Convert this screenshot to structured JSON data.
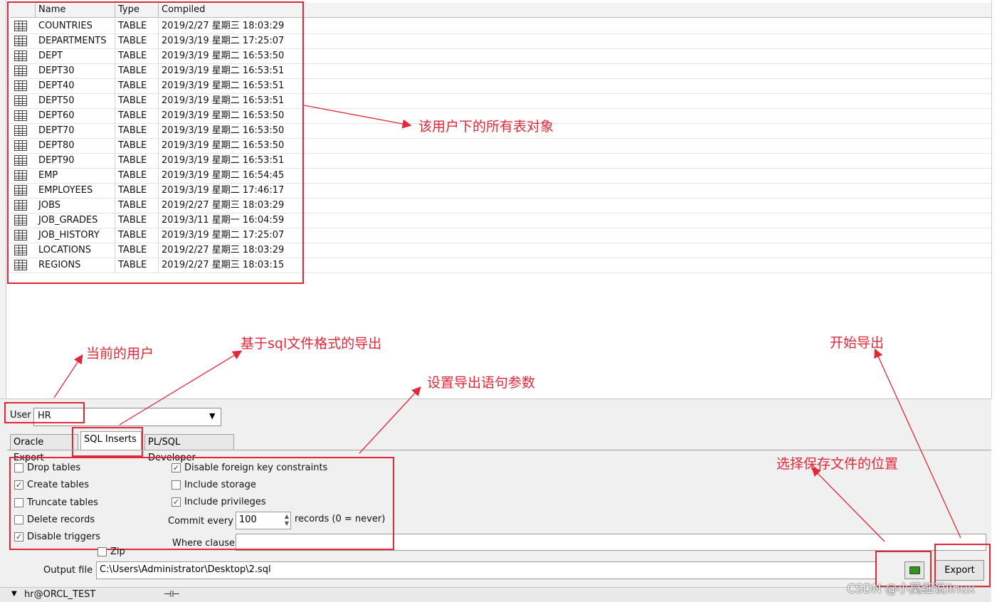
{
  "columns": [
    "Name",
    "Type",
    "Compiled"
  ],
  "tables": [
    {
      "name": "COUNTRIES",
      "type": "TABLE",
      "compiled": "2019/2/27 星期三 18:03:29"
    },
    {
      "name": "DEPARTMENTS",
      "type": "TABLE",
      "compiled": "2019/3/19 星期二 17:25:07"
    },
    {
      "name": "DEPT",
      "type": "TABLE",
      "compiled": "2019/3/19 星期二 16:53:50"
    },
    {
      "name": "DEPT30",
      "type": "TABLE",
      "compiled": "2019/3/19 星期二 16:53:51"
    },
    {
      "name": "DEPT40",
      "type": "TABLE",
      "compiled": "2019/3/19 星期二 16:53:51"
    },
    {
      "name": "DEPT50",
      "type": "TABLE",
      "compiled": "2019/3/19 星期二 16:53:51"
    },
    {
      "name": "DEPT60",
      "type": "TABLE",
      "compiled": "2019/3/19 星期二 16:53:50"
    },
    {
      "name": "DEPT70",
      "type": "TABLE",
      "compiled": "2019/3/19 星期二 16:53:50"
    },
    {
      "name": "DEPT80",
      "type": "TABLE",
      "compiled": "2019/3/19 星期二 16:53:50"
    },
    {
      "name": "DEPT90",
      "type": "TABLE",
      "compiled": "2019/3/19 星期二 16:53:51"
    },
    {
      "name": "EMP",
      "type": "TABLE",
      "compiled": "2019/3/19 星期二 16:54:45"
    },
    {
      "name": "EMPLOYEES",
      "type": "TABLE",
      "compiled": "2019/3/19 星期二 17:46:17"
    },
    {
      "name": "JOBS",
      "type": "TABLE",
      "compiled": "2019/2/27 星期三 18:03:29"
    },
    {
      "name": "JOB_GRADES",
      "type": "TABLE",
      "compiled": "2019/3/11 星期一 16:04:59"
    },
    {
      "name": "JOB_HISTORY",
      "type": "TABLE",
      "compiled": "2019/3/19 星期二 17:25:07"
    },
    {
      "name": "LOCATIONS",
      "type": "TABLE",
      "compiled": "2019/2/27 星期三 18:03:29"
    },
    {
      "name": "REGIONS",
      "type": "TABLE",
      "compiled": "2019/2/27 星期三 18:03:15"
    }
  ],
  "user": {
    "label": "User",
    "value": "HR"
  },
  "tabs": [
    {
      "label": "Oracle Export",
      "active": false
    },
    {
      "label": "SQL Inserts",
      "active": true
    },
    {
      "label": "PL/SQL Developer",
      "active": false
    }
  ],
  "options_left": [
    {
      "label": "Drop tables",
      "checked": false
    },
    {
      "label": "Create tables",
      "checked": true
    },
    {
      "label": "Truncate tables",
      "checked": false
    },
    {
      "label": "Delete records",
      "checked": false
    },
    {
      "label": "Disable triggers",
      "checked": true
    }
  ],
  "options_right": [
    {
      "label": "Disable foreign key constraints",
      "checked": true
    },
    {
      "label": "Include storage",
      "checked": false
    },
    {
      "label": "Include privileges",
      "checked": true
    }
  ],
  "commit": {
    "label": "Commit every",
    "value": "100",
    "suffix": "records (0 = never)"
  },
  "where": {
    "label": "Where clause",
    "value": ""
  },
  "zip": {
    "label": "Zip",
    "checked": false
  },
  "output": {
    "label": "Output file",
    "value": "C:\\Users\\Administrator\\Desktop\\2.sql"
  },
  "export_label": "Export",
  "status": {
    "connection": "hr@ORCL_TEST",
    "pin": "⊣⊢"
  },
  "annotations": {
    "all_tables": "该用户下的所有表对象",
    "current_user": "当前的用户",
    "sql_format": "基于sql文件格式的导出",
    "statement_params": "设置导出语句参数",
    "start_export": "开始导出",
    "save_location": "选择保存文件的位置"
  },
  "watermark": "CSDN @小莫细说linux",
  "colors": {
    "annotation": "#e0283a"
  }
}
